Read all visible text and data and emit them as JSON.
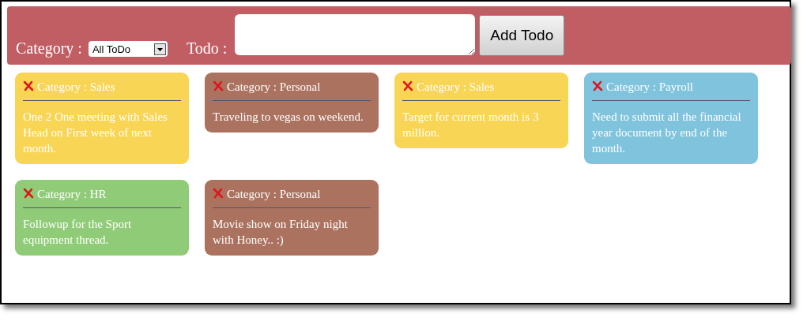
{
  "toolbar": {
    "category_label": "Category :",
    "category_select": "All ToDo",
    "todo_label": "Todo :",
    "add_button": "Add Todo"
  },
  "todos": [
    {
      "category": "Category : Sales",
      "text": "One 2 One meeting with Sales Head on First week of next month.",
      "color": "#f8d555"
    },
    {
      "category": "Category : Personal",
      "text": "Traveling to vegas on weekend.",
      "color": "#ab725f"
    },
    {
      "category": "Category : Sales",
      "text": "Target for current month is 3 million.",
      "color": "#f8d555"
    },
    {
      "category": "Category : Payroll",
      "text": "Need to submit all the financial year document by end of the month.",
      "color": "#7fc3dd"
    },
    {
      "category": "Category : HR",
      "text": "Followup for the Sport equipment thread.",
      "color": "#90cb78"
    },
    {
      "category": "Category : Personal",
      "text": "Movie show on Friday night with Honey.. :)",
      "color": "#ab725f"
    }
  ]
}
